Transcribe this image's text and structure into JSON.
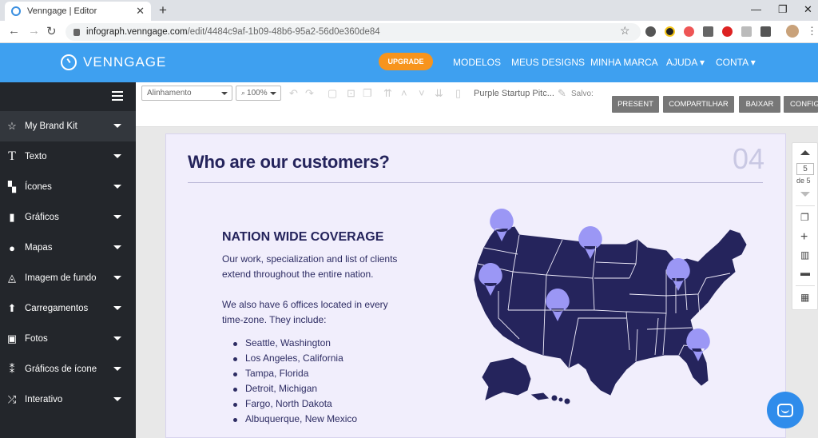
{
  "browser": {
    "tab_title": "Venngage | Editor",
    "url_host": "infograph.venngage.com",
    "url_path": "/edit/4484c9af-1b09-48b6-95a2-56d0e360de84"
  },
  "header": {
    "logo": "VENNGAGE",
    "upgrade": "UPGRADE",
    "nav": [
      "MODELOS",
      "MEUS DESIGNS",
      "MINHA MARCA",
      "AJUDA ▾",
      "CONTA ▾"
    ]
  },
  "sidebar": {
    "items": [
      {
        "label": "My Brand Kit",
        "icon": "star-icon"
      },
      {
        "label": "Texto",
        "icon": "text-icon"
      },
      {
        "label": "Ícones",
        "icon": "icons-icon"
      },
      {
        "label": "Gráficos",
        "icon": "chart-icon"
      },
      {
        "label": "Mapas",
        "icon": "globe-icon"
      },
      {
        "label": "Imagem de fundo",
        "icon": "drop-icon"
      },
      {
        "label": "Carregamentos",
        "icon": "upload-icon"
      },
      {
        "label": "Fotos",
        "icon": "photo-icon"
      },
      {
        "label": "Gráficos de ícone",
        "icon": "icon-chart-icon"
      },
      {
        "label": "Interativo",
        "icon": "shuffle-icon"
      }
    ]
  },
  "toolbar": {
    "align": "Alinhamento",
    "zoom": "100%",
    "doc_title": "Purple Startup Pitc...",
    "saved": "Salvo:",
    "buttons": [
      "PRESENT",
      "COMPARTILHAR",
      "BAIXAR",
      "CONFIG"
    ]
  },
  "slide": {
    "title": "Who are our customers?",
    "number": "04",
    "subheading": "NATION WIDE COVERAGE",
    "para1": "Our work, specialization and list of clients extend throughout the entire nation.",
    "para2": "We also have 6 offices located in every time-zone. They include:",
    "offices": [
      "Seattle, Washington",
      "Los Angeles, California",
      "Tampa, Florida",
      "Detroit, Michigan",
      "Fargo, North Dakota",
      "Albuquerque, New Mexico"
    ]
  },
  "pager": {
    "current": "5",
    "of": "de 5"
  },
  "colors": {
    "header_blue": "#3ea0f0",
    "map_navy": "#25245c",
    "pin_lavender": "#9b97f5",
    "slide_bg": "#f1eefc"
  }
}
